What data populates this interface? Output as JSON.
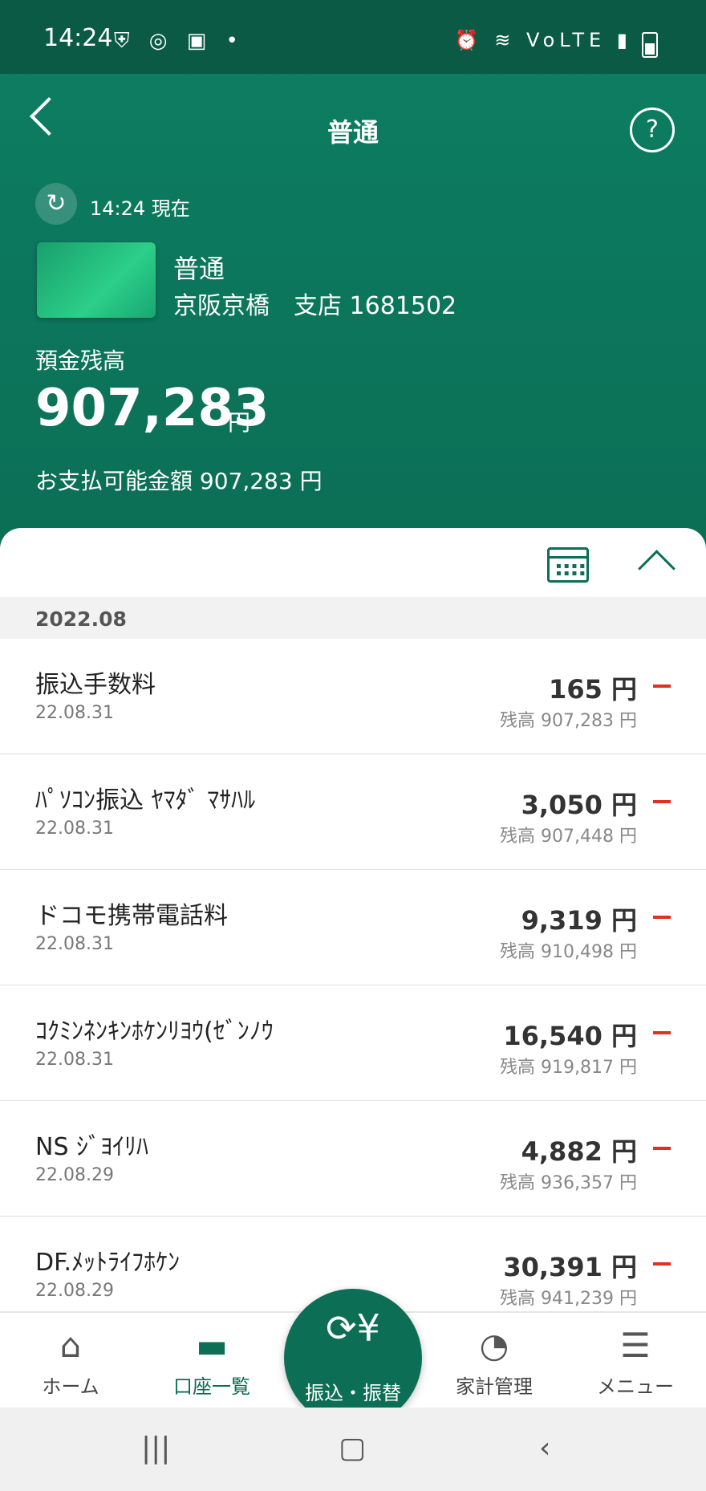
{
  "status_bar": {
    "time": "14:24",
    "left_icons": "⛨ ◎ ▣ •",
    "right_icons": "⏰ ≋ VoLTE ▮"
  },
  "header": {
    "title": "普通",
    "help_label": "?"
  },
  "update": {
    "text": "14:24 現在"
  },
  "account": {
    "name": "普通",
    "branch": "京阪京橋　支店 1681502"
  },
  "balance": {
    "label": "預金残高",
    "amount": "907,283",
    "unit": "円",
    "available": "お支払可能金額 907,283 円"
  },
  "month_header": "2022.08",
  "transactions": [
    {
      "name": "振込手数料",
      "date": "22.08.31",
      "amount": "165 円",
      "balance": "残高 907,283 円"
    },
    {
      "name": "ﾊﾟｿｺﾝ振込 ﾔﾏﾀﾞ ﾏｻﾊﾙ",
      "date": "22.08.31",
      "amount": "3,050 円",
      "balance": "残高 907,448 円"
    },
    {
      "name": "ドコモ携帯電話料",
      "date": "22.08.31",
      "amount": "9,319 円",
      "balance": "残高 910,498 円"
    },
    {
      "name": "ｺｸﾐﾝﾈﾝｷﾝﾎｹﾝﾘﾖｳ(ｾﾞﾝﾉｳ",
      "date": "22.08.31",
      "amount": "16,540 円",
      "balance": "残高 919,817 円"
    },
    {
      "name": "NS ｼﾞﾖｲﾘﾊ",
      "date": "22.08.29",
      "amount": "4,882 円",
      "balance": "残高 936,357 円"
    },
    {
      "name": "DF.ﾒｯﾄﾗｲﾌﾎｹﾝ",
      "date": "22.08.29",
      "amount": "30,391 円",
      "balance": "残高 941,239 円"
    }
  ],
  "nav": {
    "home": "ホーム",
    "accounts": "口座一覧",
    "transfer": "振込・振替",
    "household": "家計管理",
    "menu": "メニュー"
  }
}
